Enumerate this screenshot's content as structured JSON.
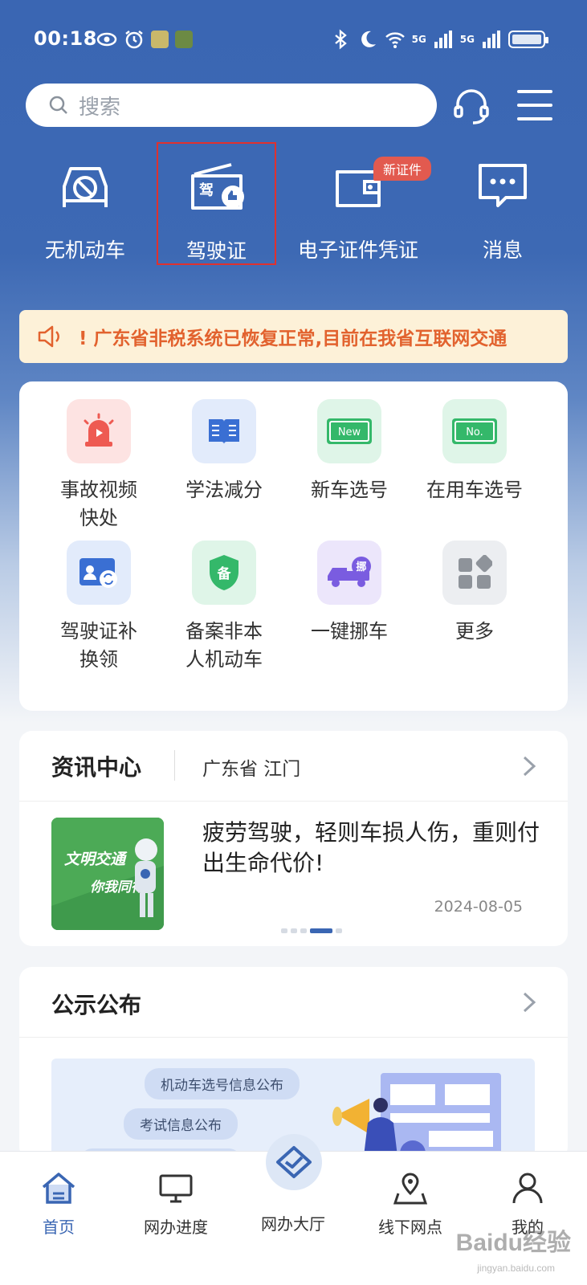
{
  "status_bar": {
    "time": "00:18",
    "net1": "5G",
    "net2": "5G"
  },
  "search": {
    "placeholder": "搜索"
  },
  "quick_actions": [
    {
      "label": "无机动车",
      "icon": "no-car-icon"
    },
    {
      "label": "驾驶证",
      "icon": "driver-license-icon"
    },
    {
      "label": "电子证件凭证",
      "icon": "wallet-icon",
      "badge": "新证件"
    },
    {
      "label": "消息",
      "icon": "message-icon"
    }
  ],
  "notice": {
    "text": "! 广东省非税系统已恢复正常,目前在我省互联网交通"
  },
  "services": [
    {
      "label": "事故视频快处",
      "icon": "siren-icon"
    },
    {
      "label": "学法减分",
      "icon": "book-icon"
    },
    {
      "label": "新车选号",
      "icon": "new-plate-icon",
      "plate": "New"
    },
    {
      "label": "在用车选号",
      "icon": "no-plate-icon",
      "plate": "No."
    },
    {
      "label": "驾驶证补换领",
      "icon": "license-renew-icon"
    },
    {
      "label": "备案非本人机动车",
      "icon": "record-shield-icon",
      "glyph": "备"
    },
    {
      "label": "一键挪车",
      "icon": "move-car-icon",
      "glyph": "挪"
    },
    {
      "label": "更多",
      "icon": "more-apps-icon"
    }
  ],
  "news": {
    "title": "资讯中心",
    "region": "广东省 江门",
    "headline": "疲劳驾驶，轻则车损人伤，重则付出生命代价!",
    "date": "2024-08-05",
    "thumb_text1": "文明交通",
    "thumb_text2": "你我同行"
  },
  "public": {
    "title": "公示公布",
    "pills": [
      "机动车选号信息公布",
      "考试信息公布"
    ]
  },
  "tabs": [
    {
      "label": "首页",
      "icon": "home-icon",
      "active": true
    },
    {
      "label": "网办进度",
      "icon": "monitor-icon"
    },
    {
      "label": "网办大厅",
      "icon": "handshake-icon"
    },
    {
      "label": "线下网点",
      "icon": "map-pin-icon"
    },
    {
      "label": "我的",
      "icon": "user-icon"
    }
  ],
  "watermark": {
    "main": "Baidu经验",
    "sub": "jingyan.baidu.com"
  },
  "colors": {
    "brand": "#3a66b3",
    "notice_text": "#e2622e",
    "highlight_border": "#e0312e"
  }
}
